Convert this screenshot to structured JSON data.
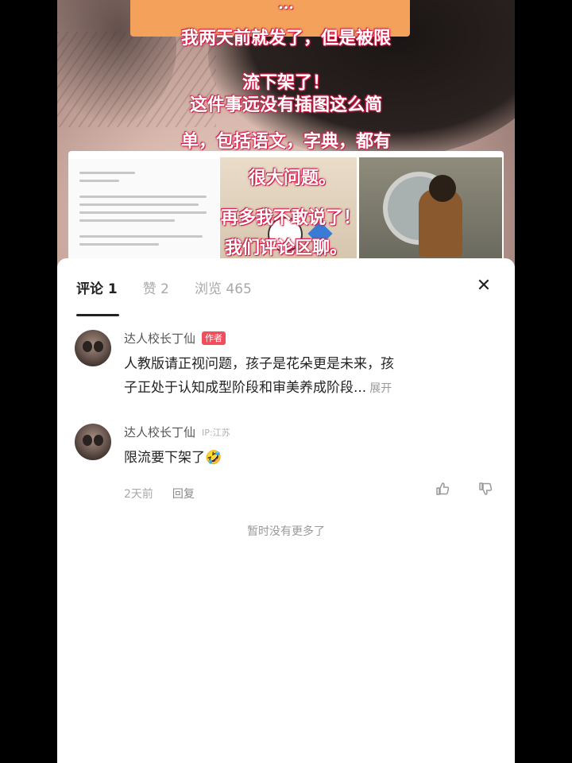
{
  "hero": {
    "overlay_lines": [
      "…",
      "我两天前就发了，但是被限",
      "流下架了！",
      "这件事远没有插图这么简",
      "单，包括语文，字典，都有",
      "很大问题。",
      "再多我不敢说了！",
      "我们评论区聊。"
    ]
  },
  "tabs": [
    {
      "label": "评论 1"
    },
    {
      "label": "赞 2"
    },
    {
      "label": "浏览 465"
    }
  ],
  "close_icon": "close-icon",
  "comments": [
    {
      "author": "达人校长丁仙",
      "badge": "作者",
      "text_line1": "人教版请正视问题，孩子是花朵更是未来，孩",
      "text_line2": "子正处于认知成型阶段和审美养成阶段...",
      "expand": "展开"
    },
    {
      "author": "达人校长丁仙",
      "location": "IP:江苏",
      "text": "限流要下架了",
      "emoji": "🤣",
      "time": "2天前",
      "reply": "回复",
      "like_icon": "thumbs-up-icon",
      "dislike_icon": "thumbs-down-icon"
    }
  ],
  "footer": {
    "no_more": "暂时没有更多了"
  }
}
